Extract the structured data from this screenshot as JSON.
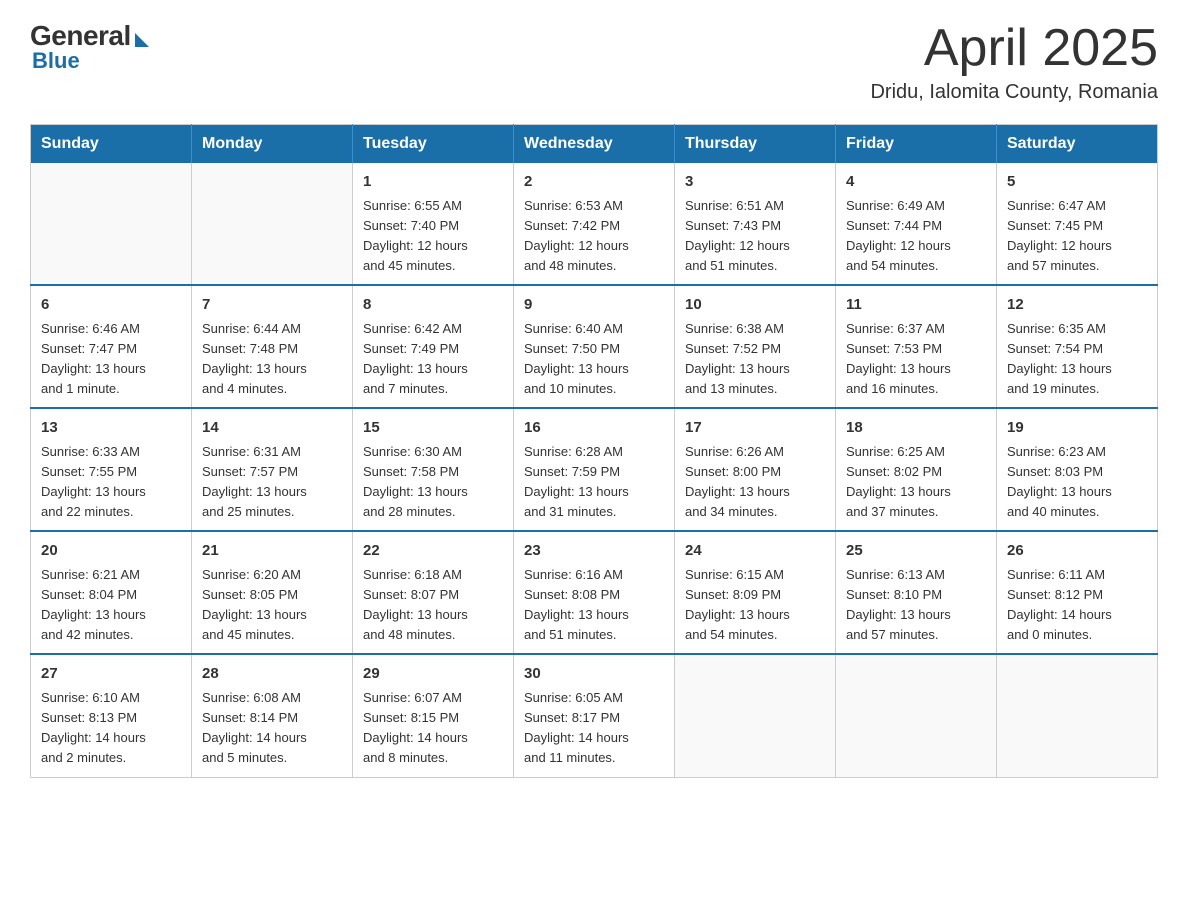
{
  "header": {
    "logo": {
      "general": "General",
      "blue": "Blue"
    },
    "title": "April 2025",
    "location": "Dridu, Ialomita County, Romania"
  },
  "calendar": {
    "days_of_week": [
      "Sunday",
      "Monday",
      "Tuesday",
      "Wednesday",
      "Thursday",
      "Friday",
      "Saturday"
    ],
    "weeks": [
      [
        {
          "day": "",
          "info": ""
        },
        {
          "day": "",
          "info": ""
        },
        {
          "day": "1",
          "info": "Sunrise: 6:55 AM\nSunset: 7:40 PM\nDaylight: 12 hours\nand 45 minutes."
        },
        {
          "day": "2",
          "info": "Sunrise: 6:53 AM\nSunset: 7:42 PM\nDaylight: 12 hours\nand 48 minutes."
        },
        {
          "day": "3",
          "info": "Sunrise: 6:51 AM\nSunset: 7:43 PM\nDaylight: 12 hours\nand 51 minutes."
        },
        {
          "day": "4",
          "info": "Sunrise: 6:49 AM\nSunset: 7:44 PM\nDaylight: 12 hours\nand 54 minutes."
        },
        {
          "day": "5",
          "info": "Sunrise: 6:47 AM\nSunset: 7:45 PM\nDaylight: 12 hours\nand 57 minutes."
        }
      ],
      [
        {
          "day": "6",
          "info": "Sunrise: 6:46 AM\nSunset: 7:47 PM\nDaylight: 13 hours\nand 1 minute."
        },
        {
          "day": "7",
          "info": "Sunrise: 6:44 AM\nSunset: 7:48 PM\nDaylight: 13 hours\nand 4 minutes."
        },
        {
          "day": "8",
          "info": "Sunrise: 6:42 AM\nSunset: 7:49 PM\nDaylight: 13 hours\nand 7 minutes."
        },
        {
          "day": "9",
          "info": "Sunrise: 6:40 AM\nSunset: 7:50 PM\nDaylight: 13 hours\nand 10 minutes."
        },
        {
          "day": "10",
          "info": "Sunrise: 6:38 AM\nSunset: 7:52 PM\nDaylight: 13 hours\nand 13 minutes."
        },
        {
          "day": "11",
          "info": "Sunrise: 6:37 AM\nSunset: 7:53 PM\nDaylight: 13 hours\nand 16 minutes."
        },
        {
          "day": "12",
          "info": "Sunrise: 6:35 AM\nSunset: 7:54 PM\nDaylight: 13 hours\nand 19 minutes."
        }
      ],
      [
        {
          "day": "13",
          "info": "Sunrise: 6:33 AM\nSunset: 7:55 PM\nDaylight: 13 hours\nand 22 minutes."
        },
        {
          "day": "14",
          "info": "Sunrise: 6:31 AM\nSunset: 7:57 PM\nDaylight: 13 hours\nand 25 minutes."
        },
        {
          "day": "15",
          "info": "Sunrise: 6:30 AM\nSunset: 7:58 PM\nDaylight: 13 hours\nand 28 minutes."
        },
        {
          "day": "16",
          "info": "Sunrise: 6:28 AM\nSunset: 7:59 PM\nDaylight: 13 hours\nand 31 minutes."
        },
        {
          "day": "17",
          "info": "Sunrise: 6:26 AM\nSunset: 8:00 PM\nDaylight: 13 hours\nand 34 minutes."
        },
        {
          "day": "18",
          "info": "Sunrise: 6:25 AM\nSunset: 8:02 PM\nDaylight: 13 hours\nand 37 minutes."
        },
        {
          "day": "19",
          "info": "Sunrise: 6:23 AM\nSunset: 8:03 PM\nDaylight: 13 hours\nand 40 minutes."
        }
      ],
      [
        {
          "day": "20",
          "info": "Sunrise: 6:21 AM\nSunset: 8:04 PM\nDaylight: 13 hours\nand 42 minutes."
        },
        {
          "day": "21",
          "info": "Sunrise: 6:20 AM\nSunset: 8:05 PM\nDaylight: 13 hours\nand 45 minutes."
        },
        {
          "day": "22",
          "info": "Sunrise: 6:18 AM\nSunset: 8:07 PM\nDaylight: 13 hours\nand 48 minutes."
        },
        {
          "day": "23",
          "info": "Sunrise: 6:16 AM\nSunset: 8:08 PM\nDaylight: 13 hours\nand 51 minutes."
        },
        {
          "day": "24",
          "info": "Sunrise: 6:15 AM\nSunset: 8:09 PM\nDaylight: 13 hours\nand 54 minutes."
        },
        {
          "day": "25",
          "info": "Sunrise: 6:13 AM\nSunset: 8:10 PM\nDaylight: 13 hours\nand 57 minutes."
        },
        {
          "day": "26",
          "info": "Sunrise: 6:11 AM\nSunset: 8:12 PM\nDaylight: 14 hours\nand 0 minutes."
        }
      ],
      [
        {
          "day": "27",
          "info": "Sunrise: 6:10 AM\nSunset: 8:13 PM\nDaylight: 14 hours\nand 2 minutes."
        },
        {
          "day": "28",
          "info": "Sunrise: 6:08 AM\nSunset: 8:14 PM\nDaylight: 14 hours\nand 5 minutes."
        },
        {
          "day": "29",
          "info": "Sunrise: 6:07 AM\nSunset: 8:15 PM\nDaylight: 14 hours\nand 8 minutes."
        },
        {
          "day": "30",
          "info": "Sunrise: 6:05 AM\nSunset: 8:17 PM\nDaylight: 14 hours\nand 11 minutes."
        },
        {
          "day": "",
          "info": ""
        },
        {
          "day": "",
          "info": ""
        },
        {
          "day": "",
          "info": ""
        }
      ]
    ]
  }
}
